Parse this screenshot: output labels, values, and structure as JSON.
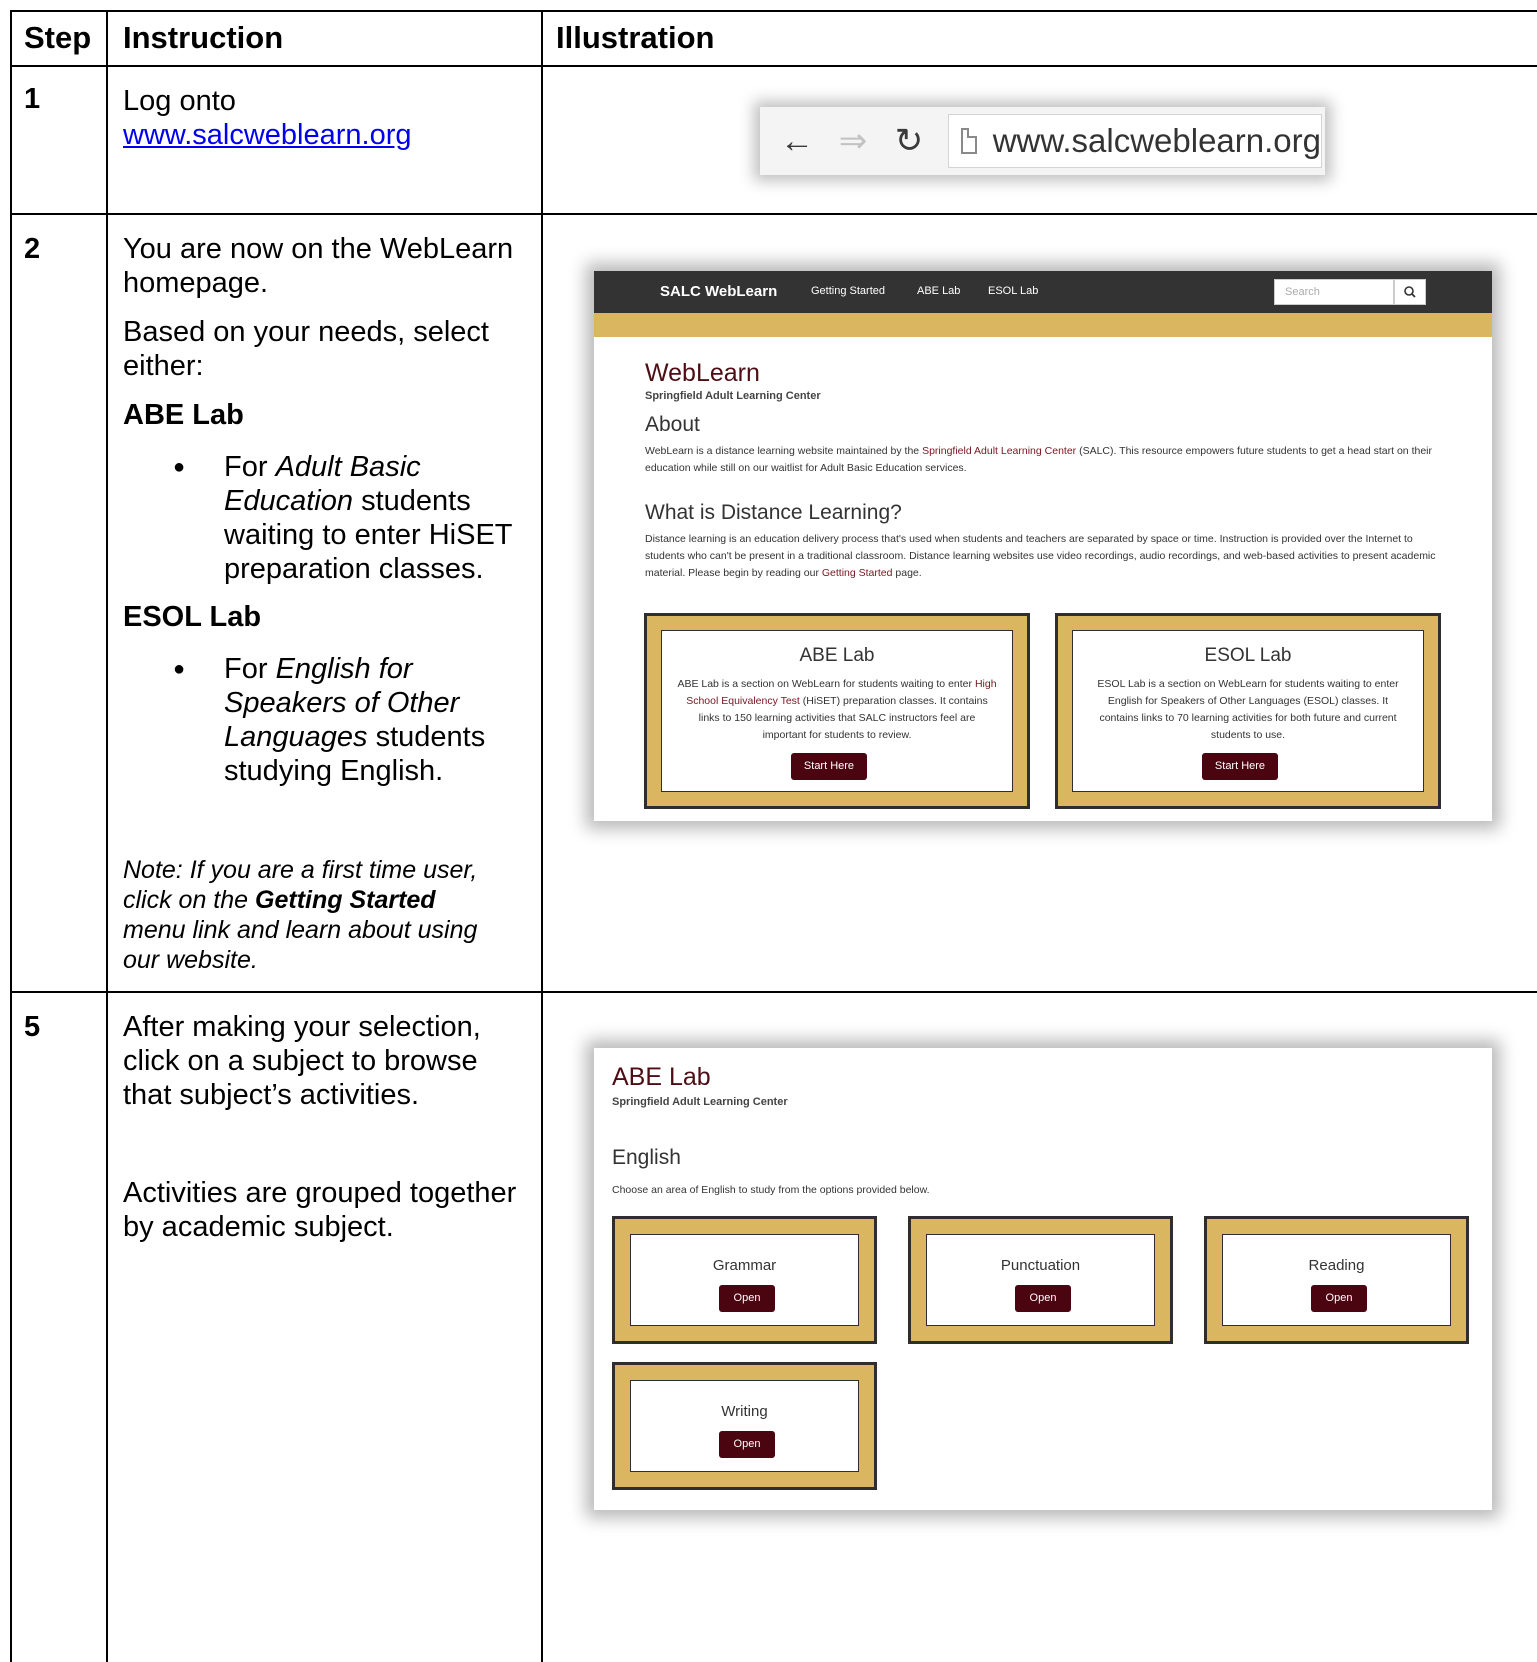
{
  "table": {
    "headers": {
      "step": "Step",
      "instruction": "Instruction",
      "illustration": "Illustration"
    },
    "rows": [
      {
        "step": "1",
        "line1": "Log onto",
        "link": "www.salcweblearn.org"
      },
      {
        "step": "2",
        "p1": "You are now on the WebLearn homepage.",
        "p2": "Based on your needs, select either:",
        "abe_heading": "ABE Lab",
        "abe_bullet_for": "For",
        "abe_bullet_em": "Adult Basic Education",
        "abe_bullet_rest": "students waiting to enter HiSET preparation classes.",
        "esol_heading": "ESOL Lab",
        "esol_bullet_for": "For",
        "esol_bullet_em": "English for Speakers of Other Languages",
        "esol_bullet_rest": "students studying English.",
        "note_pre": "Note: If you are a first time user, click on the",
        "note_bold": "Getting Started",
        "note_post": "menu link and learn about using our website."
      },
      {
        "step": "5",
        "p1": "After making your selection, click on a subject to browse that subject’s activities.",
        "p2": "Activities are grouped together by academic subject."
      }
    ]
  },
  "browser": {
    "back_icon": "arrow-left-icon",
    "forward_icon": "arrow-right-icon",
    "reload_icon": "reload-icon",
    "url": "www.salcweblearn.org"
  },
  "homepage": {
    "brand": "SALC WebLearn",
    "nav": [
      "Getting Started",
      "ABE Lab",
      "ESOL Lab"
    ],
    "search_placeholder": "Search",
    "title": "WebLearn",
    "subtitle": "Springfield Adult Learning Center",
    "about_heading": "About",
    "about_p_pre": "WebLearn is a distance learning website maintained by the",
    "about_p_link": "Springfield Adult Learning Center",
    "about_p_post": "(SALC). This resource empowers future students to get a head start on their education while still on our waitlist for Adult Basic Education services.",
    "dl_heading": "What is Distance Learning?",
    "dl_p_pre": "Distance learning is an education delivery process that's used when students and teachers are separated by space or time. Instruction is provided over the Internet to students who can't be present in a traditional classroom. Distance learning websites use video recordings, audio recordings, and web-based activities to present academic material. Please begin by reading our",
    "dl_p_link": "Getting Started",
    "dl_p_post": "page.",
    "abe_card": {
      "title": "ABE Lab",
      "desc_pre": "ABE Lab is a section on WebLearn for students waiting to enter",
      "desc_link": "High School Equivalency Test",
      "desc_post": "(HiSET) preparation classes. It contains links to 150 learning activities that SALC instructors feel are important for students to review.",
      "button": "Start Here"
    },
    "esol_card": {
      "title": "ESOL Lab",
      "desc": "ESOL Lab is a section on WebLearn for students waiting to enter English for Speakers of Other Languages (ESOL) classes. It contains links to 70 learning activities for both future and current students to use.",
      "button": "Start Here"
    }
  },
  "abe_page": {
    "title": "ABE Lab",
    "subtitle": "Springfield Adult Learning Center",
    "heading": "English",
    "intro": "Choose an area of English to study from the options provided below.",
    "subjects": [
      {
        "name": "Grammar",
        "button": "Open"
      },
      {
        "name": "Punctuation",
        "button": "Open"
      },
      {
        "name": "Reading",
        "button": "Open"
      },
      {
        "name": "Writing",
        "button": "Open"
      }
    ]
  },
  "colors": {
    "maroon": "#4a0510",
    "gold": "#d9b65f",
    "navbar": "#333333",
    "link": "#0000ee"
  }
}
